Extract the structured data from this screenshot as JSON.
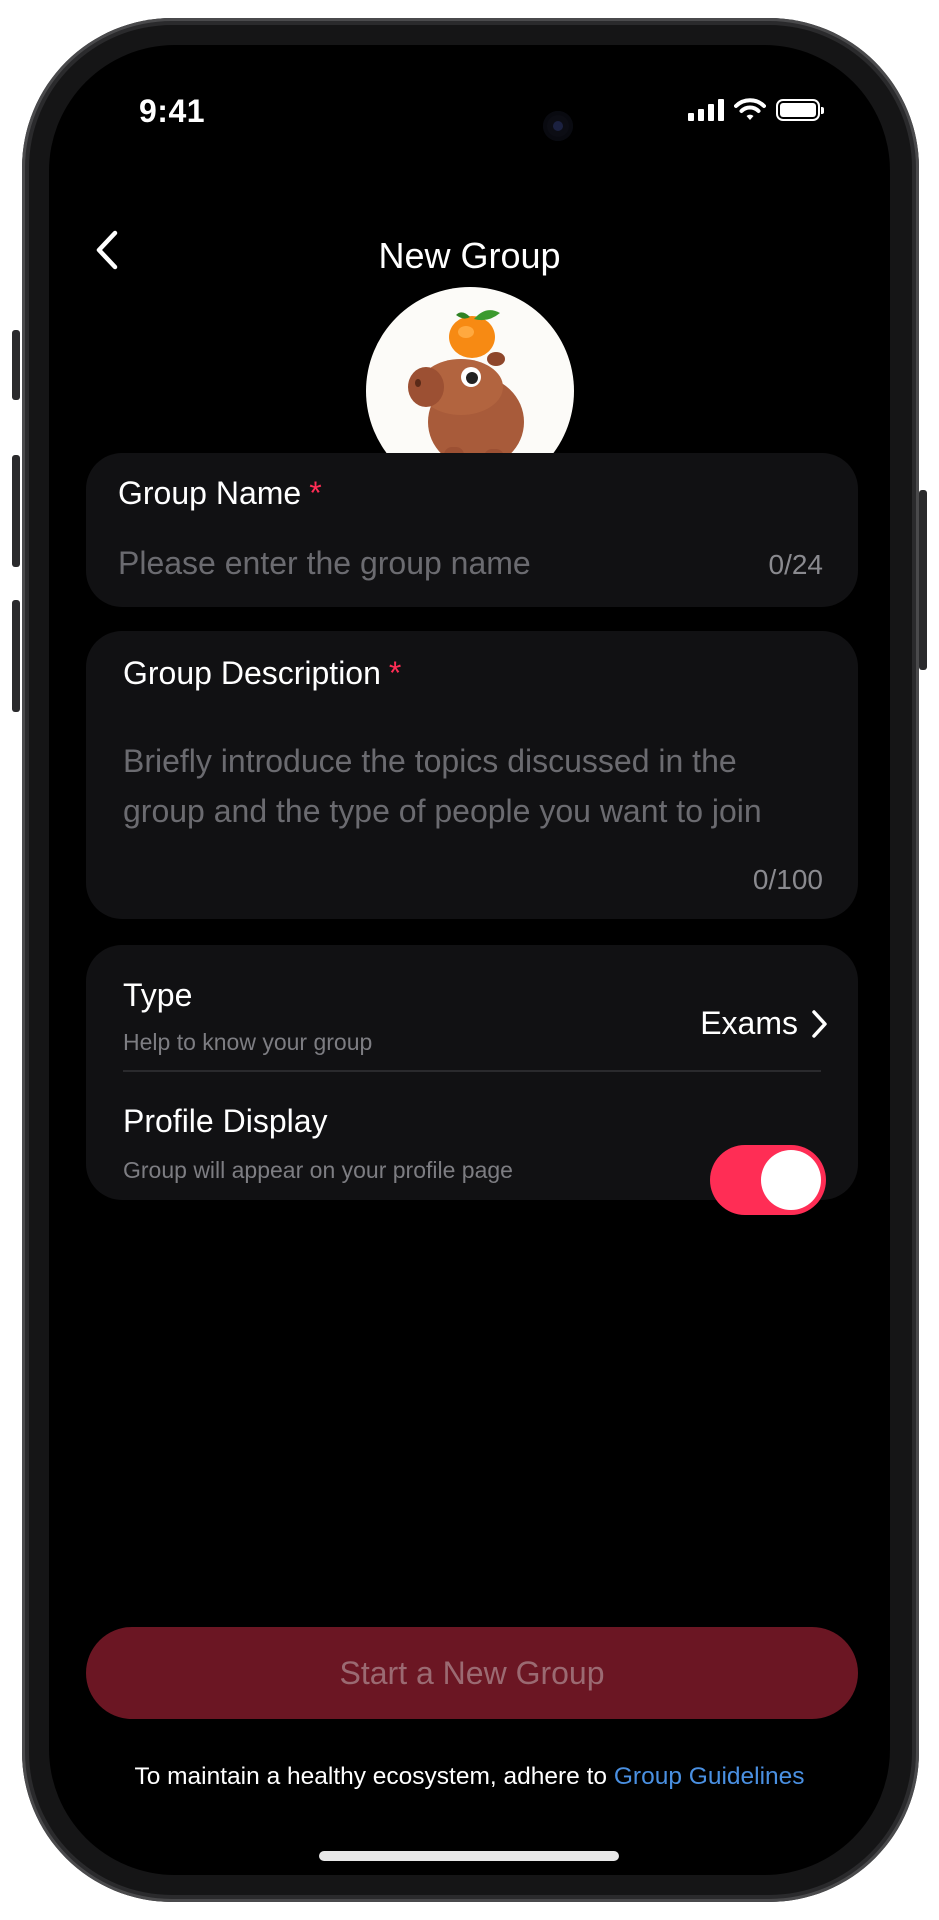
{
  "status_bar": {
    "time": "9:41"
  },
  "header": {
    "title": "New Group"
  },
  "group_name": {
    "label": "Group Name",
    "required_mark": "*",
    "placeholder": "Please enter the group name",
    "counter": "0/24"
  },
  "group_description": {
    "label": "Group Description",
    "required_mark": "*",
    "placeholder": "Briefly introduce the topics discussed in the group and the type of people you want to join",
    "counter": "0/100"
  },
  "settings": {
    "type": {
      "title": "Type",
      "subtitle": "Help to know your group",
      "value": "Exams"
    },
    "profile_display": {
      "title": "Profile Display",
      "subtitle": "Group will appear on your profile page",
      "enabled": true
    }
  },
  "cta": {
    "label": "Start a New Group"
  },
  "footer": {
    "text": "To maintain a healthy ecosystem, adhere to ",
    "link": "Group Guidelines"
  },
  "colors": {
    "accent": "#ff2d55",
    "cta_bg": "#6b1623",
    "link": "#4a90e2",
    "badge": "#ffe100"
  },
  "icons": {
    "back": "chevron-left-icon",
    "add": "plus-icon",
    "type_arrow": "chevron-right-icon"
  }
}
